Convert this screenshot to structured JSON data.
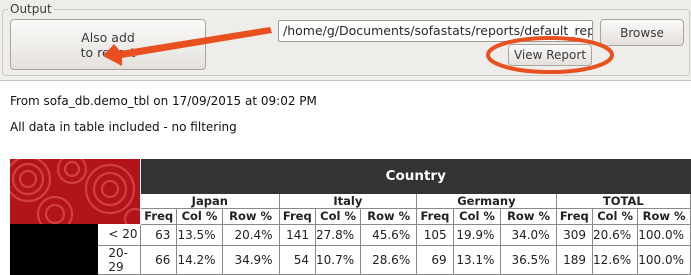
{
  "output": {
    "group_label": "Output",
    "add_button": "Also add\nto report",
    "path_value": "/home/g/Documents/sofastats/reports/default_report.htm",
    "browse_button": "Browse",
    "view_report_button": "View Report",
    "annotation_color": "#e8501f"
  },
  "report": {
    "source_line": "From sofa_db.demo_tbl on 17/09/2015 at 09:02 PM",
    "filter_line": "All data in table included - no filtering",
    "table": {
      "col_var": "Country",
      "groups": [
        "Japan",
        "Italy",
        "Germany",
        "TOTAL"
      ],
      "subheaders": [
        "Freq",
        "Col %",
        "Row %"
      ],
      "rows": [
        {
          "label": "< 20",
          "cells": [
            "63",
            "13.5%",
            "20.4%",
            "141",
            "27.8%",
            "45.6%",
            "105",
            "19.9%",
            "34.0%",
            "309",
            "20.6%",
            "100.0%"
          ]
        },
        {
          "label": "20-29",
          "cells": [
            "66",
            "14.2%",
            "34.9%",
            "54",
            "10.7%",
            "28.6%",
            "69",
            "13.1%",
            "36.5%",
            "189",
            "12.6%",
            "100.0%"
          ]
        }
      ],
      "header_bg": "#333333",
      "corner_color": "#b3141a"
    }
  }
}
